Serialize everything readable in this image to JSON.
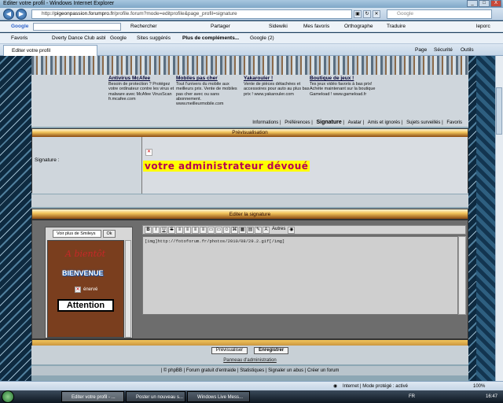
{
  "window": {
    "title": "Editer votre profil - Windows Internet Explorer",
    "min": "_",
    "max": "□",
    "close": "X"
  },
  "address": {
    "url_prefix": "http://",
    "url_domain": "pigeonpassion.forumpro.fr",
    "url_path": "/profile.forum?mode=editprofile&page_profil=signature",
    "search_placeholder": "Google"
  },
  "google_toolbar": {
    "logo": "Google",
    "items": [
      "Rechercher",
      "Partager",
      "Sidewiki",
      "Mes favoris",
      "Orthographe",
      "Traduire",
      "leporc"
    ]
  },
  "favorites_bar": {
    "favoris": "Favoris",
    "items": [
      "Dverty Dance Club asbl",
      "Google",
      "Sites suggérés",
      "Plus de compléments...",
      "Google (2)"
    ]
  },
  "tab": {
    "active_title": "Editer votre profil",
    "commands": [
      "Page",
      "Sécurité",
      "Outils"
    ]
  },
  "ads": [
    {
      "title": "Antivirus McAfee",
      "text": "Besoin de protection ? Protégez votre ordinateur contre les virus et malware avec McAfee VirusScan fr.mcafee.com"
    },
    {
      "title": "Mobiles pas cher",
      "text": "Tout l'univers du mobile aux meilleurs prix. Vente de mobiles pas cher avec ou sans abonnement. www.meilleurmobile.com"
    },
    {
      "title": "Yakarouler !",
      "text": "Vente de pièces détachées et accessoires pour auto au plus bas prix ! www.yakarouler.com"
    },
    {
      "title": "Boutique de jeux !",
      "text": "Tes jeux vidéo favoris à bas prix! Achète maintenant sur la boutique Gameload ! www.gameload.fr"
    }
  ],
  "profile_nav": [
    "Informations",
    "Préférences",
    "Signature",
    "Avatar",
    "Amis et ignorés",
    "Sujets surveillés",
    "Favoris"
  ],
  "preview": {
    "header": "Prévisualisation",
    "label": "Signature :",
    "signature_text": "votre administrateur dévoué"
  },
  "editor": {
    "header": "Editer la signature",
    "smiley_select": "Voir plus de Smileys",
    "smiley_ok": "Ok",
    "smileys": [
      "A bientôt",
      "BIENVENUE",
      "énervé",
      "Attention"
    ],
    "toolbar": [
      "B",
      "I",
      "U",
      "S",
      "≡",
      "≡",
      "≡",
      "≡",
      "▭",
      "▭",
      "☺",
      "⌘",
      "▦",
      "▤",
      "✎",
      "A",
      "Autres",
      "◉"
    ],
    "content": "[img]http://fotoforum.fr/photos/2010/08/29.2.gif[/img]"
  },
  "buttons": {
    "preview": "Prévisualiser",
    "save": "Enregistrer"
  },
  "admin_link": "Panneau d'administration",
  "footer": "| © phpBB | Forum gratuit d'entraide | Statistiques | Signaler un abus | Créer un forum",
  "statusbar": {
    "zone": "Internet | Mode protégé : activé",
    "zoom": "100%"
  },
  "taskbar": {
    "tasks": [
      "Editer votre profil - ...",
      "Poster un nouveau s...",
      "Windows Live Mess..."
    ],
    "lang": "FR",
    "clock": "16:47"
  }
}
